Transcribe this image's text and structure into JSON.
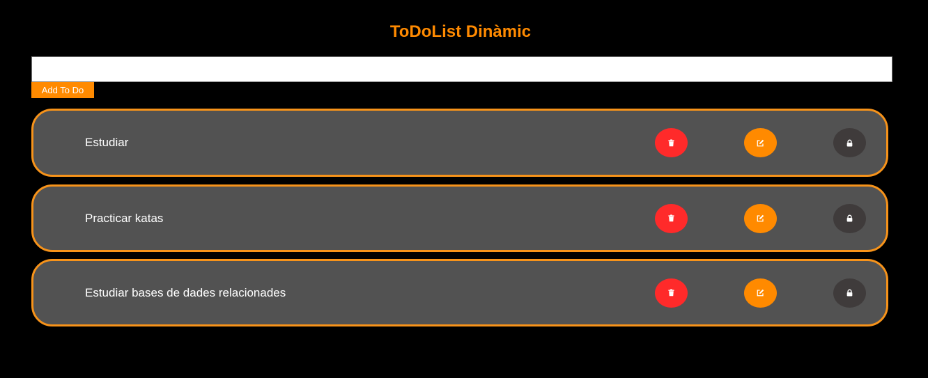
{
  "header": {
    "title": "ToDoList Dinàmic"
  },
  "form": {
    "input_value": "",
    "add_label": "Add To Do"
  },
  "colors": {
    "accent": "#ff8a00",
    "card_border": "#f7931a",
    "card_background": "#525252",
    "delete": "#ff2a2a",
    "edit": "#ff8a00",
    "lock": "#3f3b3b"
  },
  "todos": [
    {
      "text": "Estudiar",
      "icons": [
        "trash-icon",
        "edit-icon",
        "lock-icon"
      ]
    },
    {
      "text": "Practicar katas",
      "icons": [
        "trash-icon",
        "edit-icon",
        "lock-icon"
      ]
    },
    {
      "text": "Estudiar bases de dades relacionades",
      "icons": [
        "trash-icon",
        "edit-icon",
        "lock-icon"
      ]
    }
  ]
}
